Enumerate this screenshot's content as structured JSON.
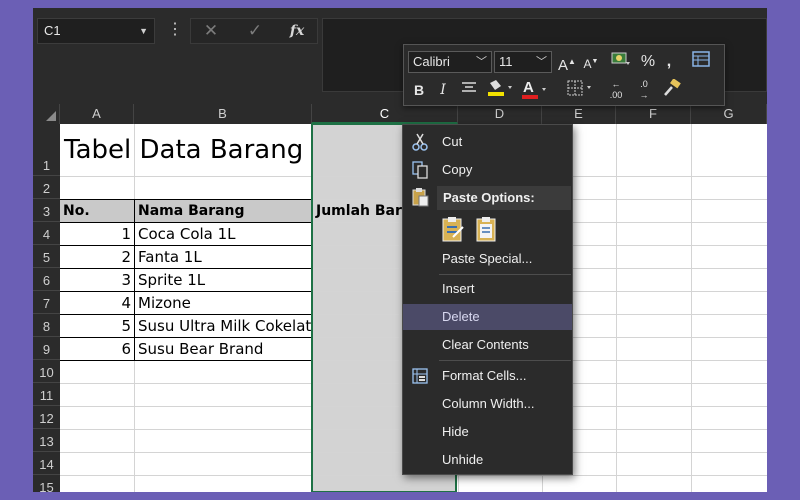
{
  "formula_bar": {
    "name_box": "C1",
    "more": "⋮",
    "cancel": "✕",
    "enter": "✓",
    "fx": "fx"
  },
  "columns": [
    "A",
    "B",
    "C",
    "D",
    "E",
    "F",
    "G"
  ],
  "rows": [
    "1",
    "2",
    "3",
    "4",
    "5",
    "6",
    "7",
    "8",
    "9",
    "10",
    "11",
    "12",
    "13",
    "14",
    "15"
  ],
  "sheet": {
    "title": "Tabel Data Barang",
    "headers": {
      "no": "No.",
      "name": "Nama Barang",
      "qty": "Jumlah Bara"
    },
    "items": [
      {
        "no": "1",
        "name": "Coca Cola 1L"
      },
      {
        "no": "2",
        "name": "Fanta 1L"
      },
      {
        "no": "3",
        "name": "Sprite 1L"
      },
      {
        "no": "4",
        "name": "Mizone"
      },
      {
        "no": "5",
        "name": "Susu Ultra Milk Cokelat"
      },
      {
        "no": "6",
        "name": "Susu Bear Brand"
      }
    ]
  },
  "mini_toolbar": {
    "font": "Calibri",
    "size": "11",
    "grow": "A",
    "shrink": "A",
    "percent": "%",
    "comma": ",",
    "bold": "B",
    "italic": "I",
    "font_color_letter": "A",
    "dec_increase": ".00",
    "dec_decrease": ".0"
  },
  "context_menu": {
    "cut": "Cut",
    "copy": "Copy",
    "paste_options": "Paste Options:",
    "paste_special": "Paste Special...",
    "insert": "Insert",
    "delete": "Delete",
    "clear_contents": "Clear Contents",
    "format_cells": "Format Cells...",
    "column_width": "Column Width...",
    "hide": "Hide",
    "unhide": "Unhide"
  },
  "colors": {
    "background": "#6b5fb5",
    "selection_border": "#1e7145",
    "menu_highlight": "#4b4a67"
  }
}
